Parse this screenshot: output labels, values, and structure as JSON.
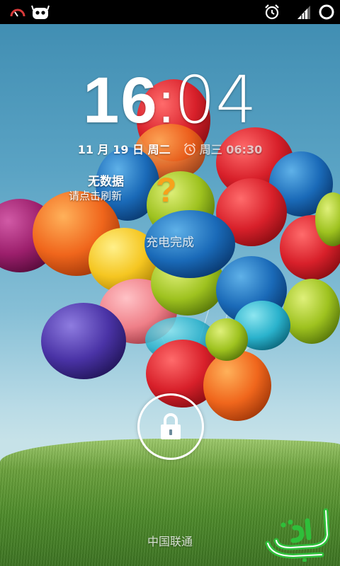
{
  "status_bar": {
    "left_icons": [
      "data-gauge-icon",
      "android-robot-icon"
    ],
    "right_icons": [
      "alarm-clock-icon",
      "signal-strength-icon",
      "battery-ring-icon"
    ]
  },
  "lockscreen": {
    "clock": {
      "hour": "16",
      "separator": ":",
      "minute": "04"
    },
    "date": "11 月 19 日 周二",
    "alarm": {
      "icon": "alarm-icon",
      "text": "周三 06:30"
    },
    "weather": {
      "title": "无数据",
      "subtitle": "请点击刷新",
      "icon_glyph": "?",
      "icon_color": "#f7a21b"
    },
    "charging_status": "充电完成",
    "unlock": {
      "icon": "padlock-icon"
    },
    "carrier": "中国联通"
  },
  "colors": {
    "status_bar_bg": "#000000",
    "text": "#ffffff",
    "gauge_red": "#d83a3a"
  }
}
